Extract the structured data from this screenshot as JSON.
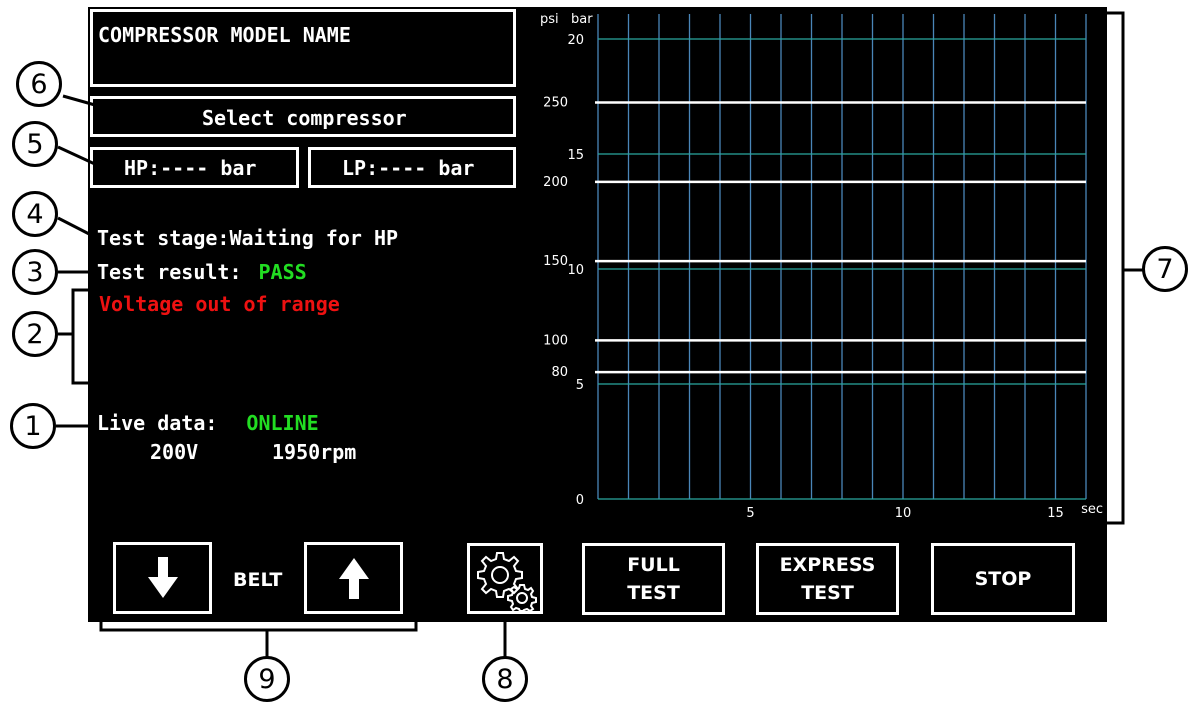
{
  "model_name": "COMPRESSOR MODEL NAME",
  "select_label": "Select compressor",
  "hp_label": "HP:---- bar",
  "lp_label": "LP:---- bar",
  "test_stage": {
    "label": "Test stage:",
    "value": "Waiting for HP"
  },
  "test_result": {
    "label": "Test result:",
    "value": "PASS",
    "value_color": "#22dd22"
  },
  "message": {
    "text": "Voltage out of range",
    "color": "#ee1111"
  },
  "live_data": {
    "label": "Live data:",
    "status": "ONLINE",
    "status_color": "#22dd22",
    "voltage": "200V",
    "rpm": "1950rpm"
  },
  "belt": {
    "label": "BELT",
    "down_icon": "arrow-down-icon",
    "up_icon": "arrow-up-icon"
  },
  "settings_icon": "gears-icon",
  "buttons": {
    "full_test": [
      "FULL",
      "TEST"
    ],
    "express_test": [
      "EXPRESS",
      "TEST"
    ],
    "stop": "STOP"
  },
  "callouts": [
    "1",
    "2",
    "3",
    "4",
    "5",
    "6",
    "7",
    "8",
    "9"
  ],
  "chart_data": {
    "type": "line",
    "left_axis_label": "psi",
    "right_axis_label": "bar",
    "xlabel": "sec",
    "xlim": [
      0,
      16
    ],
    "x_ticks": [
      "5",
      "10",
      "15"
    ],
    "bar_ticks": [
      "0",
      "5",
      "10",
      "15",
      "20"
    ],
    "psi_ticks": [
      "80",
      "100",
      "150",
      "200",
      "250"
    ],
    "grid": true,
    "series": []
  }
}
